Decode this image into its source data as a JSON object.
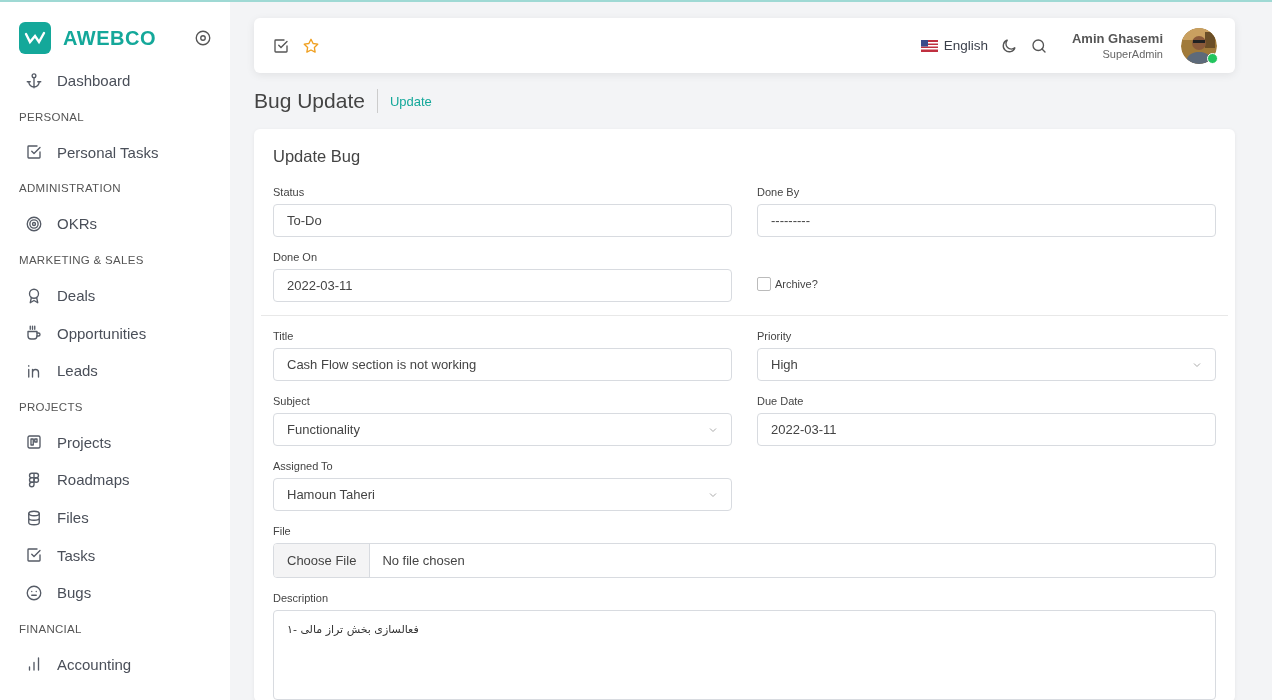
{
  "sidebar": {
    "brand": "AWEBCO",
    "items": [
      {
        "kind": "link",
        "label": "Dashboard"
      },
      {
        "kind": "heading",
        "label": "PERSONAL"
      },
      {
        "kind": "link",
        "label": "Personal Tasks"
      },
      {
        "kind": "heading",
        "label": "ADMINISTRATION"
      },
      {
        "kind": "link",
        "label": "OKRs"
      },
      {
        "kind": "heading",
        "label": "MARKETING & SALES"
      },
      {
        "kind": "link",
        "label": "Deals"
      },
      {
        "kind": "link",
        "label": "Opportunities"
      },
      {
        "kind": "link",
        "label": "Leads"
      },
      {
        "kind": "heading",
        "label": "PROJECTS"
      },
      {
        "kind": "link",
        "label": "Projects"
      },
      {
        "kind": "link",
        "label": "Roadmaps"
      },
      {
        "kind": "link",
        "label": "Files"
      },
      {
        "kind": "link",
        "label": "Tasks"
      },
      {
        "kind": "link",
        "label": "Bugs"
      },
      {
        "kind": "heading",
        "label": "FINANCIAL"
      },
      {
        "kind": "link",
        "label": "Accounting"
      }
    ]
  },
  "header": {
    "language": "English",
    "user": {
      "name": "Amin Ghasemi",
      "role": "SuperAdmin",
      "online": true
    }
  },
  "page": {
    "title": "Bug Update",
    "breadcrumb": "Update"
  },
  "form": {
    "title": "Update Bug",
    "sections": [
      {
        "fields": [
          {
            "kind": "text",
            "label": "Status",
            "value": "To-Do"
          },
          {
            "kind": "text",
            "label": "Done By",
            "value": "---------"
          },
          {
            "kind": "text",
            "label": "Done On",
            "value": "2022-03-11"
          },
          {
            "kind": "checkbox",
            "label": "Archive?",
            "checked": false
          }
        ]
      },
      {
        "fields": [
          {
            "kind": "text",
            "label": "Title",
            "value": "Cash Flow section is not working"
          },
          {
            "kind": "select",
            "label": "Priority",
            "value": "High"
          },
          {
            "kind": "select",
            "label": "Subject",
            "value": "Functionality"
          },
          {
            "kind": "text",
            "label": "Due Date",
            "value": "2022-03-11"
          },
          {
            "kind": "select",
            "label": "Assigned To",
            "value": "Hamoun Taheri"
          },
          {
            "kind": "spacer"
          },
          {
            "kind": "file",
            "label": "File",
            "button": "Choose File",
            "value": "No file chosen"
          },
          {
            "kind": "textarea",
            "label": "Description",
            "value": "فعالسازی بخش تراز مالی -۱"
          }
        ]
      }
    ]
  }
}
